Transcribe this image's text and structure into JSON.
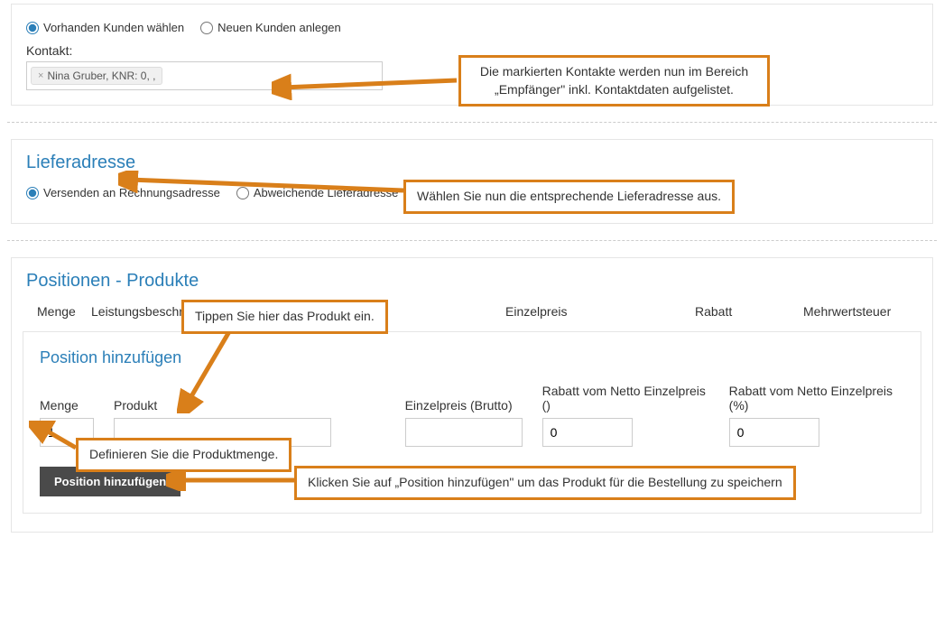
{
  "top": {
    "radio_existing": "Vorhanden Kunden wählen",
    "radio_new": "Neuen Kunden anlegen",
    "contact_label": "Kontakt:",
    "contact_tag": "Nina Gruber, KNR: 0, ,"
  },
  "callouts": {
    "c1_line1": "Die markierten Kontakte werden nun im Bereich",
    "c1_line2": "„Empfänger\" inkl. Kontaktdaten aufgelistet.",
    "c2": "Wählen Sie nun die entsprechende Lieferadresse aus.",
    "c3": "Tippen Sie hier das Produkt ein.",
    "c4": "Definieren Sie die Produktmenge.",
    "c5": "Klicken Sie auf „Position hinzufügen\" um das Produkt für die Bestellung zu speichern"
  },
  "delivery": {
    "title": "Lieferadresse",
    "radio_billing": "Versenden an Rechnungsadresse",
    "radio_other": "Abweichende Lieferadresse"
  },
  "positions": {
    "title": "Positionen - Produkte",
    "th_menge": "Menge",
    "th_leist": "Leistungsbeschreibung",
    "th_ep": "Einzelpreis",
    "th_rab": "Rabatt",
    "th_mwst": "Mehrwertsteuer"
  },
  "add": {
    "title": "Position hinzufügen",
    "menge_label": "Menge",
    "menge_value": "1",
    "produkt_label": "Produkt",
    "ep_label": "Einzelpreis (Brutto)",
    "rabatt_label": "Rabatt vom Netto Einzelpreis ()",
    "rabatt_value": "0",
    "rabatt_pct_label": "Rabatt vom Netto Einzelpreis (%)",
    "rabatt_pct_value": "0",
    "btn": "Position hinzufügen"
  }
}
